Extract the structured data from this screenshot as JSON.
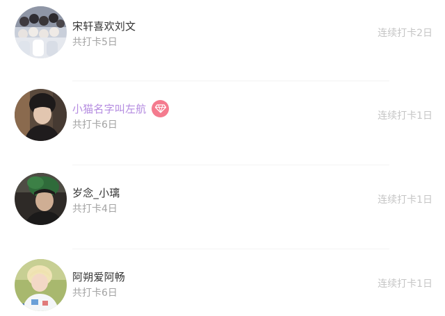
{
  "checkin_list": [
    {
      "name": "宋轩喜欢刘文",
      "total": "共打卡5日",
      "streak": "连续打卡2日",
      "vip": false,
      "avatar": "group-photo-avatar"
    },
    {
      "name": "小猫名字叫左航",
      "total": "共打卡6日",
      "streak": "连续打卡1日",
      "vip": true,
      "vip_icon": "diamond-icon",
      "avatar": "boy-portrait-avatar"
    },
    {
      "name": "岁念_小璃",
      "total": "共打卡4日",
      "streak": "连续打卡1日",
      "vip": false,
      "avatar": "boy-green-hat-avatar"
    },
    {
      "name": "阿朔爱阿畅",
      "total": "共打卡6日",
      "streak": "连续打卡1日",
      "vip": false,
      "avatar": "blond-boy-avatar"
    }
  ],
  "colors": {
    "name": "#333333",
    "vip_name": "#b48be0",
    "vip_badge": "#f47b8e",
    "secondary_text": "#a3a3a3",
    "streak_text": "#c5c5c5"
  }
}
